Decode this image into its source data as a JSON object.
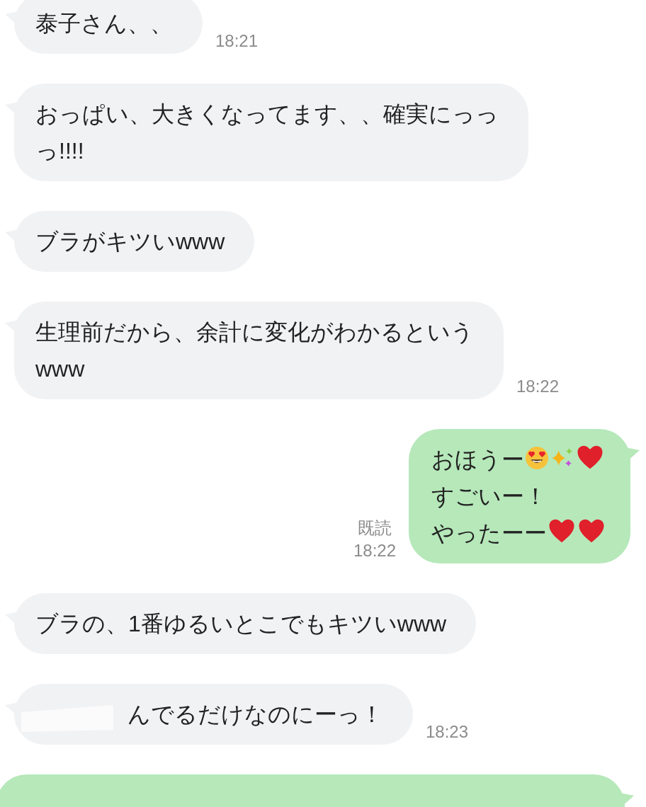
{
  "messages": [
    {
      "kind": "received",
      "lines": [
        [
          {
            "kind": "text",
            "text": "泰子さん、、"
          }
        ]
      ],
      "time": "18:21"
    },
    {
      "kind": "received",
      "lines": [
        [
          {
            "kind": "text",
            "text": "おっぱい、大きくなってます、、確実にっっ"
          }
        ],
        [
          {
            "kind": "text",
            "text": "っ!!!!"
          }
        ]
      ]
    },
    {
      "kind": "received",
      "lines": [
        [
          {
            "kind": "text",
            "text": "ブラがキツいwww"
          }
        ]
      ]
    },
    {
      "kind": "received",
      "lines": [
        [
          {
            "kind": "text",
            "text": "生理前だから、余計に変化がわかるという"
          }
        ],
        [
          {
            "kind": "text",
            "text": "www"
          }
        ]
      ],
      "time": "18:22"
    },
    {
      "kind": "sent",
      "lines": [
        [
          {
            "kind": "text",
            "text": "おほうー"
          },
          {
            "kind": "face"
          },
          {
            "kind": "sparkle"
          },
          {
            "kind": "heart"
          }
        ],
        [
          {
            "kind": "text",
            "text": "すごいー！"
          }
        ],
        [
          {
            "kind": "text",
            "text": "やったーー"
          },
          {
            "kind": "heart"
          },
          {
            "kind": "heart"
          }
        ]
      ],
      "read": "既読",
      "time": "18:22"
    },
    {
      "kind": "received",
      "lines": [
        [
          {
            "kind": "text",
            "text": "ブラの、1番ゆるいとこでもキツいwww"
          }
        ]
      ]
    },
    {
      "kind": "received",
      "redacted": true,
      "lines": [
        [
          {
            "kind": "text",
            "text": "んでるだけなのにーっ！"
          }
        ]
      ],
      "time": "18:23"
    },
    {
      "kind": "sent",
      "cut": true
    }
  ]
}
